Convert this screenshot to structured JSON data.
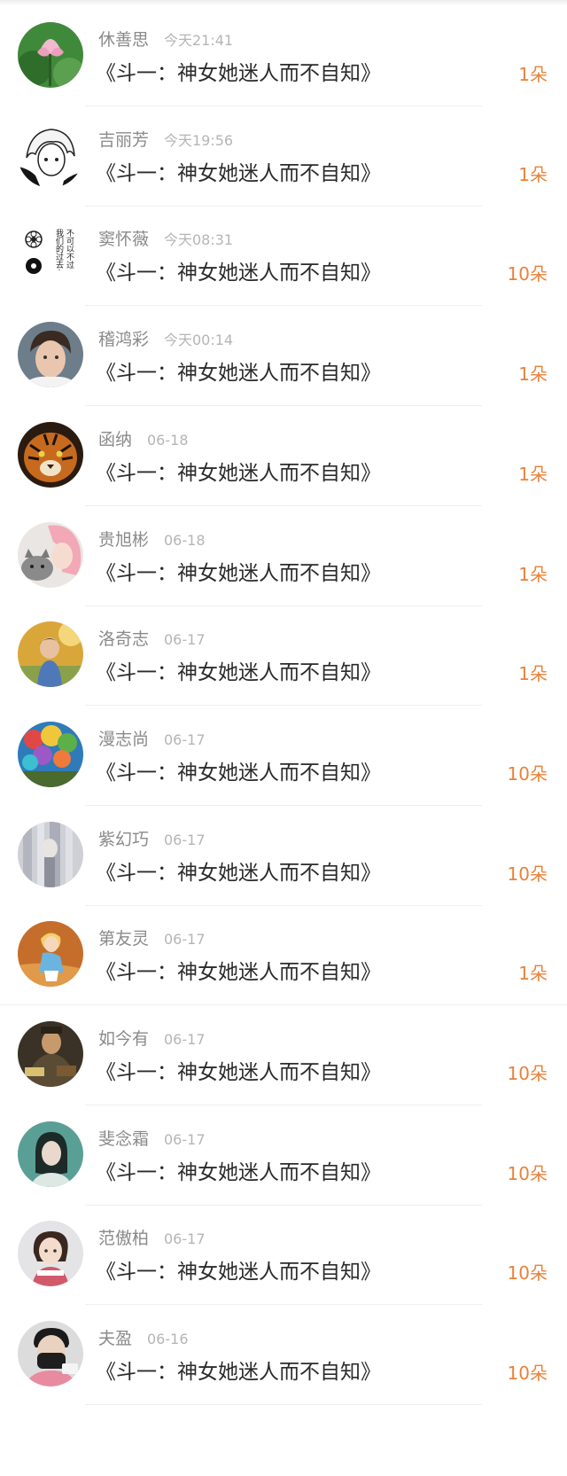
{
  "gift_list": {
    "items": [
      {
        "user": "休善思",
        "time": "今天21:41",
        "book_title": "《斗一：神女她迷人而不自知》",
        "gift": "1朵",
        "avatar": "lotus-avatar"
      },
      {
        "user": "吉丽芳",
        "time": "今天19:56",
        "book_title": "《斗一：神女她迷人而不自知》",
        "gift": "1朵",
        "avatar": "anime-boy-avatar"
      },
      {
        "user": "窦怀薇",
        "time": "今天08:31",
        "book_title": "《斗一：神女她迷人而不自知》",
        "gift": "10朵",
        "avatar": "flower-text-avatar",
        "avatar_text_1": "我们的过去·",
        "avatar_text_2": "不可以不过"
      },
      {
        "user": "稽鸿彩",
        "time": "今天00:14",
        "book_title": "《斗一：神女她迷人而不自知》",
        "gift": "1朵",
        "avatar": "young-man-avatar"
      },
      {
        "user": "函纳",
        "time": "06-18",
        "book_title": "《斗一：神女她迷人而不自知》",
        "gift": "1朵",
        "avatar": "tiger-avatar"
      },
      {
        "user": "贵旭彬",
        "time": "06-18",
        "book_title": "《斗一：神女她迷人而不自知》",
        "gift": "1朵",
        "avatar": "pink-hair-cat-avatar"
      },
      {
        "user": "洛奇志",
        "time": "06-17",
        "book_title": "《斗一：神女她迷人而不自知》",
        "gift": "1朵",
        "avatar": "child-field-avatar"
      },
      {
        "user": "漫志尚",
        "time": "06-17",
        "book_title": "《斗一：神女她迷人而不自知》",
        "gift": "10朵",
        "avatar": "balloons-avatar"
      },
      {
        "user": "紫幻巧",
        "time": "06-17",
        "book_title": "《斗一：神女她迷人而不自知》",
        "gift": "10朵",
        "avatar": "curtain-avatar"
      },
      {
        "user": "第友灵",
        "time": "06-17",
        "book_title": "《斗一：神女她迷人而不自知》",
        "gift": "1朵",
        "avatar": "cartoon-girl-avatar"
      },
      {
        "user": "如今有",
        "time": "06-17",
        "book_title": "《斗一：神女她迷人而不自知》",
        "gift": "10朵",
        "avatar": "poster-avatar"
      },
      {
        "user": "斐念霜",
        "time": "06-17",
        "book_title": "《斗一：神女她迷人而不自知》",
        "gift": "10朵",
        "avatar": "teal-portrait-avatar"
      },
      {
        "user": "范傲柏",
        "time": "06-17",
        "book_title": "《斗一：神女她迷人而不自知》",
        "gift": "10朵",
        "avatar": "little-girl-avatar"
      },
      {
        "user": "夫盈",
        "time": "06-16",
        "book_title": "《斗一：神女她迷人而不自知》",
        "gift": "10朵",
        "avatar": "masked-man-avatar"
      }
    ]
  },
  "colors": {
    "gift_accent": "#e8823a",
    "name_gray": "#8a8a8a",
    "time_gray": "#b5b5b5",
    "title_dark": "#2b2b2b"
  }
}
